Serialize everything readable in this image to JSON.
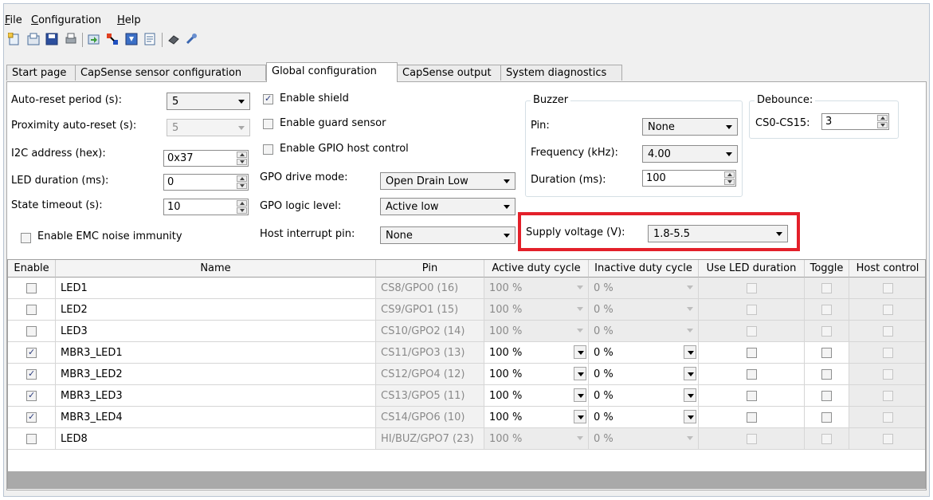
{
  "menu": {
    "file": "File",
    "configuration": "Configuration",
    "help": "Help"
  },
  "tabs": [
    "Start page",
    "CapSense sensor configuration",
    "Global configuration",
    "CapSense output",
    "System diagnostics"
  ],
  "left": {
    "auto_reset_label": "Auto-reset period (s):",
    "auto_reset_value": "5",
    "prox_reset_label": "Proximity auto-reset (s):",
    "prox_reset_value": "5",
    "i2c_label": "I2C address (hex):",
    "i2c_value": "0x37",
    "led_duration_label": "LED duration (ms):",
    "led_duration_value": "0",
    "state_timeout_label": "State timeout (s):",
    "state_timeout_value": "10",
    "emc_label": "Enable EMC noise immunity"
  },
  "middle": {
    "enable_shield": "Enable shield",
    "enable_guard": "Enable guard sensor",
    "enable_gpio": "Enable GPIO host control",
    "gpo_drive_label": "GPO drive mode:",
    "gpo_drive_value": "Open Drain Low",
    "gpo_logic_label": "GPO logic level:",
    "gpo_logic_value": "Active low",
    "host_int_label": "Host interrupt pin:",
    "host_int_value": "None"
  },
  "buzzer": {
    "title": "Buzzer",
    "pin_label": "Pin:",
    "pin_value": "None",
    "freq_label": "Frequency (kHz):",
    "freq_value": "4.00",
    "duration_label": "Duration (ms):",
    "duration_value": "100"
  },
  "debounce": {
    "title": "Debounce:",
    "label": "CS0-CS15:",
    "value": "3"
  },
  "supply": {
    "label": "Supply voltage (V):",
    "value": "1.8-5.5"
  },
  "table": {
    "headers": [
      "Enable",
      "Name",
      "Pin",
      "Active duty cycle",
      "Inactive duty cycle",
      "Use LED duration",
      "Toggle",
      "Host control"
    ],
    "rows": [
      {
        "enabled": false,
        "name": "LED1",
        "pin": "CS8/GPO0 (16)",
        "active": "100 %",
        "inactive": "0 %"
      },
      {
        "enabled": false,
        "name": "LED2",
        "pin": "CS9/GPO1 (15)",
        "active": "100 %",
        "inactive": "0 %"
      },
      {
        "enabled": false,
        "name": "LED3",
        "pin": "CS10/GPO2 (14)",
        "active": "100 %",
        "inactive": "0 %"
      },
      {
        "enabled": true,
        "name": "MBR3_LED1",
        "pin": "CS11/GPO3 (13)",
        "active": "100 %",
        "inactive": "0 %"
      },
      {
        "enabled": true,
        "name": "MBR3_LED2",
        "pin": "CS12/GPO4 (12)",
        "active": "100 %",
        "inactive": "0 %"
      },
      {
        "enabled": true,
        "name": "MBR3_LED3",
        "pin": "CS13/GPO5 (11)",
        "active": "100 %",
        "inactive": "0 %"
      },
      {
        "enabled": true,
        "name": "MBR3_LED4",
        "pin": "CS14/GPO6 (10)",
        "active": "100 %",
        "inactive": "0 %"
      },
      {
        "enabled": false,
        "name": "LED8",
        "pin": "HI/BUZ/GPO7 (23)",
        "active": "100 %",
        "inactive": "0 %"
      }
    ]
  },
  "colors": {
    "highlight": "#e3202a",
    "checkmark": "#2a3a7c"
  }
}
